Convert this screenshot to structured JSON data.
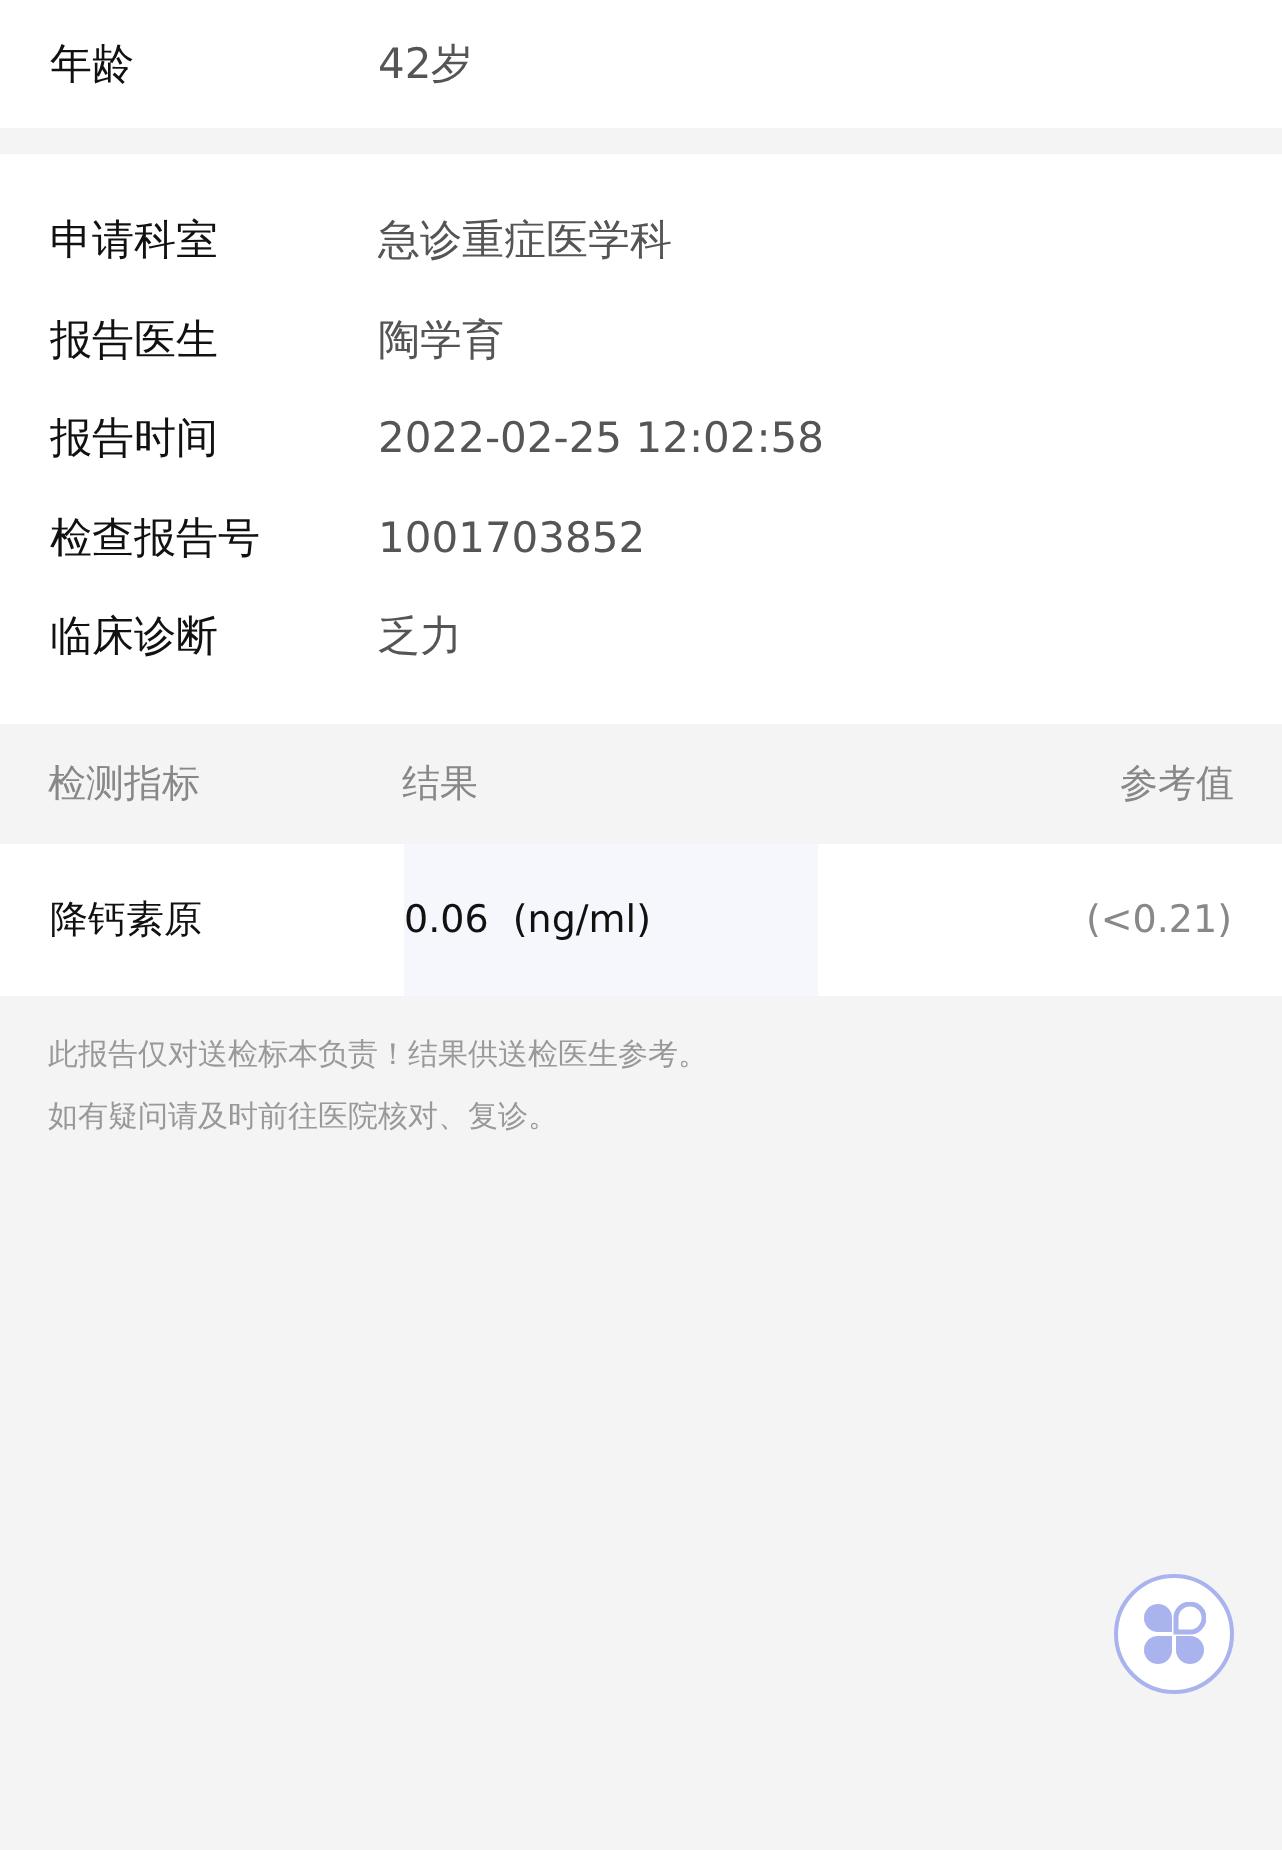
{
  "patient": [
    {
      "label": "年龄",
      "value": "42岁"
    }
  ],
  "report": [
    {
      "label": "申请科室",
      "value": "急诊重症医学科"
    },
    {
      "label": "报告医生",
      "value": "陶学育"
    },
    {
      "label": "报告时间",
      "value": "2022-02-25 12:02:58"
    },
    {
      "label": "检查报告号",
      "value": "1001703852"
    },
    {
      "label": "临床诊断",
      "value": "乏力"
    }
  ],
  "table": {
    "columns": [
      "检测指标",
      "结果",
      "参考值"
    ],
    "rows": [
      {
        "name": "降钙素原",
        "result": "0.06  (ng/ml)",
        "reference": "(<0.21)"
      }
    ]
  },
  "notes": [
    "此报告仅对送检标本负责！结果供送检医生参考。",
    "如有疑问请及时前往医院核对、复诊。"
  ]
}
